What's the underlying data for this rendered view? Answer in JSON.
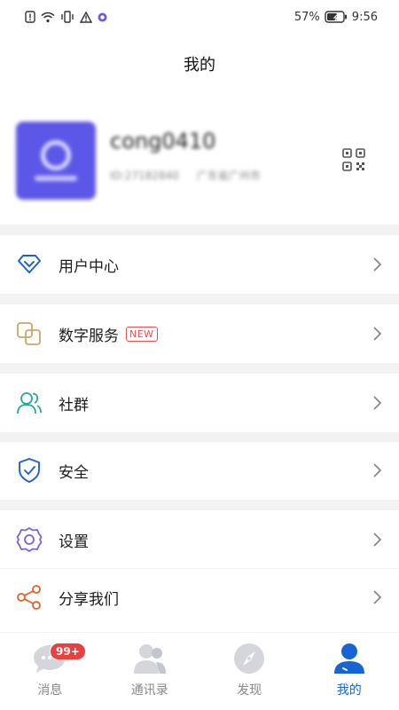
{
  "status_bar": {
    "battery": "57%",
    "time": "9:56"
  },
  "header": {
    "title": "我的"
  },
  "profile": {
    "username": "cong0410",
    "user_id": "ID:27182840",
    "location": "广东省广州市"
  },
  "menu": [
    {
      "label": "用户中心",
      "icon": "diamond-icon"
    },
    {
      "label": "数字服务",
      "badge": "NEW",
      "icon": "digital-service-icon"
    },
    {
      "label": "社群",
      "icon": "community-icon"
    },
    {
      "label": "安全",
      "icon": "shield-check-icon"
    },
    {
      "label": "设置",
      "icon": "gear-icon"
    },
    {
      "label": "分享我们",
      "icon": "share-icon"
    }
  ],
  "tabbar": {
    "tabs": [
      {
        "label": "消息",
        "badge": "99+"
      },
      {
        "label": "通讯录"
      },
      {
        "label": "发现"
      },
      {
        "label": "我的"
      }
    ],
    "active_color": "#1765d4",
    "inactive_color": "#888888"
  }
}
